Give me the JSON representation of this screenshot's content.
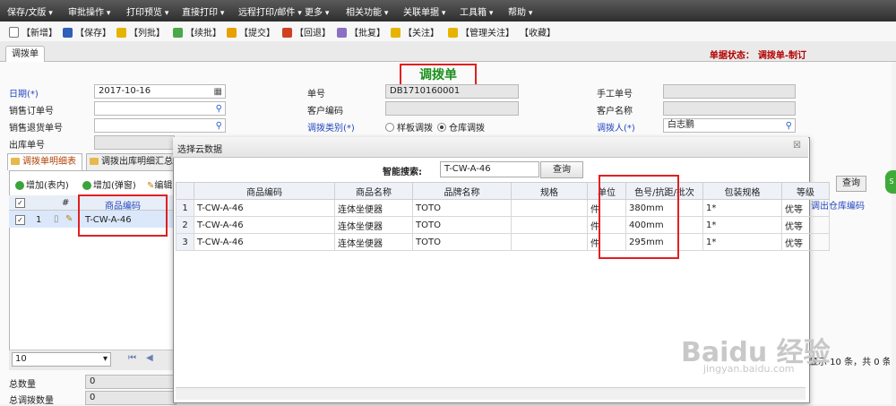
{
  "menu": [
    "保存/文版",
    "审批操作",
    "打印预览",
    "直接打印",
    "远程打印/邮件",
    "更多",
    "相关功能",
    "关联单据",
    "工具箱",
    "帮助"
  ],
  "toolbar": [
    {
      "label": "【新增】",
      "icon": "new-doc-icon",
      "color": "#ffffff"
    },
    {
      "label": "【保存】",
      "icon": "save-icon",
      "color": "#2f5fb7"
    },
    {
      "label": "【列批】",
      "icon": "check-icon",
      "color": "#e6b400"
    },
    {
      "label": "【续批】",
      "icon": "continue-icon",
      "color": "#4aa84a"
    },
    {
      "label": "【提交】",
      "icon": "submit-icon",
      "color": "#e6a000"
    },
    {
      "label": "【回退】",
      "icon": "rollback-icon",
      "color": "#d04020"
    },
    {
      "label": "【批复】",
      "icon": "reply-icon",
      "color": "#8a6fc4"
    },
    {
      "label": "【关注】",
      "icon": "watch-icon",
      "color": "#e6b400"
    },
    {
      "label": "【管理关注】",
      "icon": "manage-watch-icon",
      "color": "#e6b400"
    },
    {
      "label": "【收藏】",
      "icon": "favorite-icon",
      "color": "#ffffff"
    }
  ],
  "tab": {
    "label": "调拨单"
  },
  "status": {
    "label": "单据状态：",
    "value": "调拨单-制订"
  },
  "form": {
    "title": "调拨单",
    "date_label": "日期(*)",
    "date_value": "2017-10-16",
    "docno_label": "单号",
    "docno_value": "DB1710160001",
    "manual_label": "手工单号",
    "sales_order_label": "销售订单号",
    "cust_code_label": "客户编码",
    "cust_name_label": "客户名称",
    "sales_return_label": "销售退货单号",
    "transfer_type_label": "调拨类别(*)",
    "transfer_type_opt1": "样板调拨",
    "transfer_type_opt2": "仓库调拨",
    "transferor_label": "调拨人(*)",
    "transferor_value": "白志鹏",
    "out_no_label": "出库单号",
    "total_qty_label": "总数量",
    "total_qty_value": "0",
    "total_sum_label": "总调拨数量",
    "total_sum_value": "0"
  },
  "subtabs": [
    "调拨单明细表",
    "调拨出库明细汇总表"
  ],
  "grid": {
    "add_inline": "增加(表内)",
    "add_popup": "增加(弹窗)",
    "edit": "编辑",
    "col_no": "#",
    "col_code": "商品编码",
    "row_no": "1",
    "row_code": "T-CW-A-46",
    "page_size": "10",
    "right_col": "调出仓库编码",
    "right_query": "查询",
    "right_footer": "显示 10 条，共 0 条"
  },
  "popup": {
    "title": "选择云数据",
    "close": "☒",
    "search_label": "智能搜索:",
    "search_value": "T-CW-A-46",
    "query": "查询",
    "headers": [
      "",
      "商品编码",
      "商品名称",
      "品牌名称",
      "规格",
      "单位",
      "色号/抗距/批次",
      "包装规格",
      "等级"
    ],
    "rows": [
      [
        "1",
        "T-CW-A-46",
        "连体坐便器",
        "TOTO",
        "",
        "件",
        "380mm",
        "1*",
        "优等"
      ],
      [
        "2",
        "T-CW-A-46",
        "连体坐便器",
        "TOTO",
        "",
        "件",
        "400mm",
        "1*",
        "优等"
      ],
      [
        "3",
        "T-CW-A-46",
        "连体坐便器",
        "TOTO",
        "",
        "件",
        "295mm",
        "1*",
        "优等"
      ]
    ]
  },
  "watermark": {
    "main": "Baidu 经验",
    "sub": "jingyan.baidu.com"
  },
  "colors": {
    "accent_red": "#e02020",
    "title_green": "#1a8f1a",
    "status_red": "#b30000",
    "link_blue": "#2547c0"
  }
}
